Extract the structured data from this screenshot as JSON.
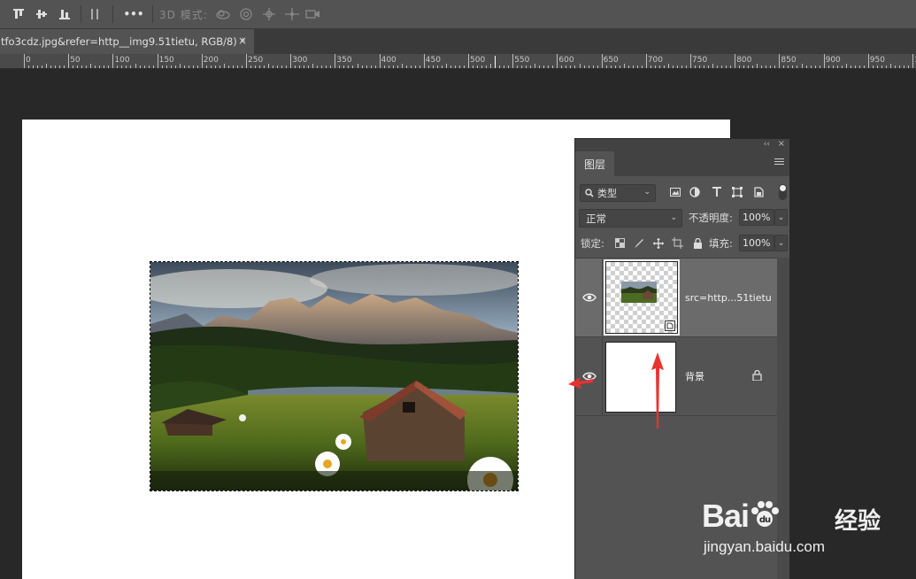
{
  "options_bar": {
    "mode_3d_label": "3D 模式:",
    "more_label": "•••"
  },
  "document_tab": {
    "title": "tfo3cdz.jpg&refer=http__img9.51tietu, RGB/8) *",
    "close": "×"
  },
  "ruler": {
    "labels": [
      "0",
      "50",
      "100",
      "150",
      "200",
      "250",
      "300",
      "350",
      "400",
      "450",
      "500",
      "550",
      "600",
      "650",
      "700",
      "750",
      "800",
      "850",
      "900",
      "950",
      "100"
    ]
  },
  "layers_panel": {
    "tab_label": "图层",
    "collapse_glyph": "‹‹",
    "close_glyph": "×",
    "filter": {
      "kind_label": "类型",
      "chevron": "⌄"
    },
    "blend_mode": "正常",
    "opacity_label": "不透明度:",
    "opacity_value": "100%",
    "lock_label": "锁定:",
    "fill_label": "填充:",
    "fill_value": "100%",
    "layers": [
      {
        "name": "src=http...51tietu",
        "selected": true,
        "visible": true,
        "locked": false
      },
      {
        "name": "背景",
        "selected": false,
        "visible": true,
        "locked": true
      }
    ]
  },
  "watermark": {
    "brand": "Bai",
    "brand2": "du",
    "cn": "经验",
    "url": "jingyan.baidu.com"
  },
  "colors": {
    "accent_arrow": "#e8332f",
    "panel_bg": "#535353",
    "workspace_bg": "#282828"
  }
}
